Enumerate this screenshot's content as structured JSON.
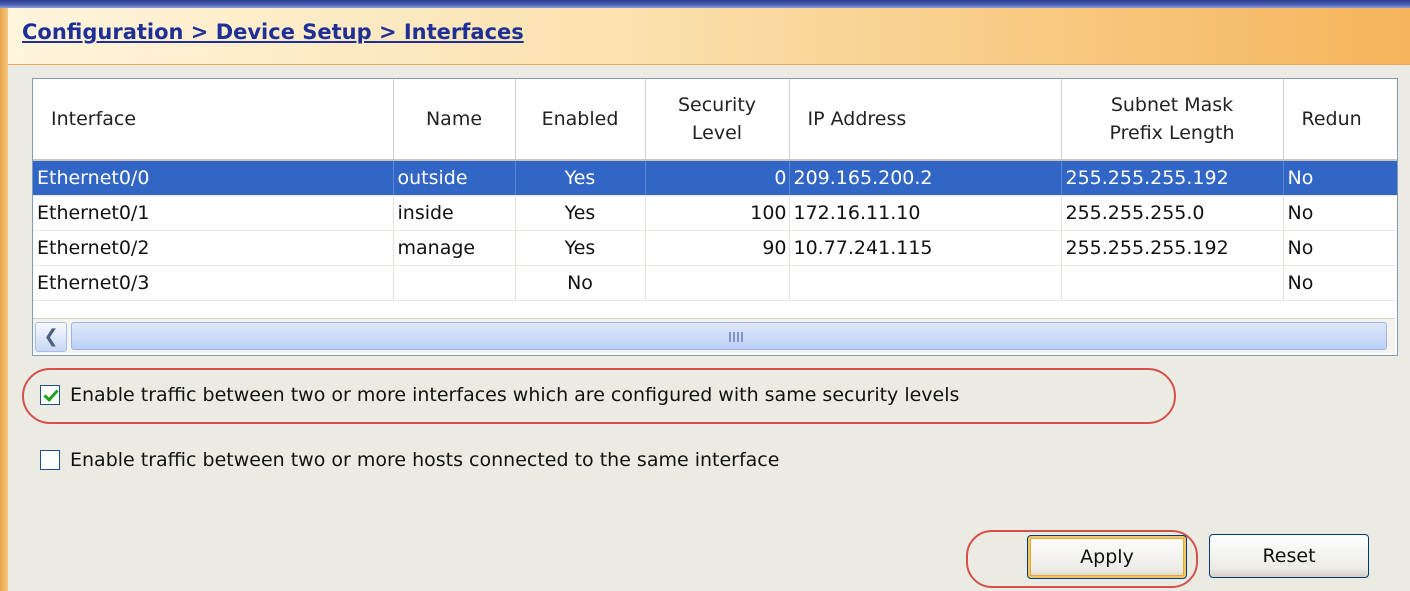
{
  "breadcrumb": "Configuration > Device Setup > Interfaces",
  "table": {
    "columns": [
      "Interface",
      "Name",
      "Enabled",
      "Security\nLevel",
      "IP Address",
      "Subnet Mask\nPrefix Length",
      "Redun"
    ],
    "rows": [
      {
        "interface": "Ethernet0/0",
        "name": "outside",
        "enabled": "Yes",
        "security_level": "0",
        "ip_address": "209.165.200.2",
        "subnet_mask": "255.255.255.192",
        "redundant": "No",
        "selected": true
      },
      {
        "interface": "Ethernet0/1",
        "name": "inside",
        "enabled": "Yes",
        "security_level": "100",
        "ip_address": "172.16.11.10",
        "subnet_mask": "255.255.255.0",
        "redundant": "No"
      },
      {
        "interface": "Ethernet0/2",
        "name": "manage",
        "enabled": "Yes",
        "security_level": "90",
        "ip_address": "10.77.241.115",
        "subnet_mask": "255.255.255.192",
        "redundant": "No"
      },
      {
        "interface": "Ethernet0/3",
        "name": "",
        "enabled": "No",
        "security_level": "",
        "ip_address": "",
        "subnet_mask": "",
        "redundant": "No"
      }
    ]
  },
  "options": [
    {
      "label": "Enable traffic between two or more interfaces which are configured with same security levels",
      "checked": true
    },
    {
      "label": "Enable traffic between two or more hosts connected to the same interface",
      "checked": false
    }
  ],
  "buttons": {
    "apply": "Apply",
    "reset": "Reset"
  },
  "colors": {
    "selection": "#3166c6",
    "highlight": "#d4504a",
    "link": "#1f2f98"
  },
  "icons": {
    "scroll_left": "chevron-left-icon",
    "checkbox": "checkmark-icon"
  }
}
